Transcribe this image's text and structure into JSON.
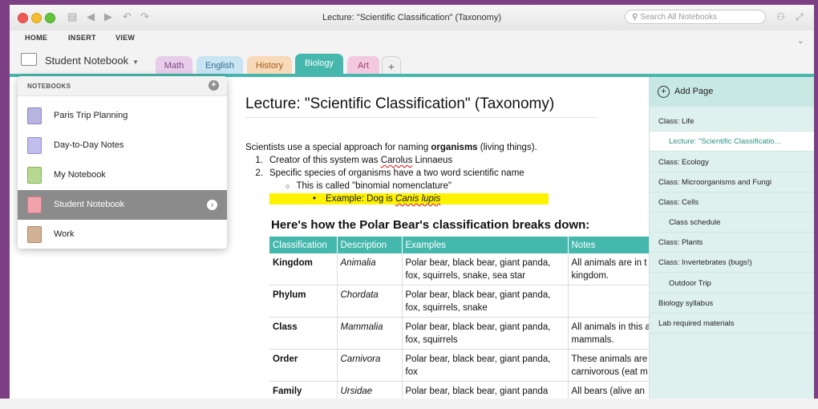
{
  "window": {
    "title": "Lecture: \"Scientific Classification\" (Taxonomy)",
    "search_placeholder": "Search All Notebooks"
  },
  "ribbon": {
    "tabs": [
      "HOME",
      "INSERT",
      "VIEW"
    ]
  },
  "notebook_selector": {
    "label": "Student Notebook"
  },
  "section_tabs": [
    {
      "label": "Math",
      "color": "#e7cde9"
    },
    {
      "label": "English",
      "color": "#c9e4f3"
    },
    {
      "label": "History",
      "color": "#f8d9b8"
    },
    {
      "label": "Biology",
      "color": "#46b7ad"
    },
    {
      "label": "Art",
      "color": "#f3c9df"
    },
    {
      "label": "+",
      "color": "#f0f0f0"
    }
  ],
  "notebooks": {
    "header": "NOTEBOOKS",
    "items": [
      {
        "label": "Paris Trip Planning",
        "color": "#b8b4e0"
      },
      {
        "label": "Day-to-Day Notes",
        "color": "#c1bdec"
      },
      {
        "label": "My Notebook",
        "color": "#b6d98f"
      },
      {
        "label": "Student Notebook",
        "color": "#f1a3ad",
        "selected": true
      },
      {
        "label": "Work",
        "color": "#d1b295"
      }
    ]
  },
  "page": {
    "title": "Lecture: \"Scientific Classification\" (Taxonomy)",
    "intro_prefix": "Scientists use a special approach for naming ",
    "intro_bold": "organisms",
    "intro_suffix": " (living things).",
    "list1_num": "1.",
    "list1_prefix": "Creator of this system was ",
    "list1_name": "Carolus",
    "list1_suffix": " Linnaeus",
    "list2_num": "2.",
    "list2_text": "Specific species of organisms have a two word scientific name",
    "sub_bullet": "○",
    "sub_text": "This is called \"binomial nomenclature\"",
    "example_bullet": "•",
    "example_prefix": "Example:  Dog is ",
    "example_italic": "Canis lupis",
    "subheading": "Here's how the Polar Bear's classification breaks down:",
    "table": {
      "headers": [
        "Classification",
        "Description",
        "Examples",
        "Notes"
      ],
      "rows": [
        [
          "Kingdom",
          "Animalia",
          "Polar bear, black bear, giant panda, fox, squirrels, snake, sea star",
          "All animals are in t kingdom."
        ],
        [
          "Phylum",
          "Chordata",
          "Polar bear, black bear, giant panda, fox, squirrels, snake",
          ""
        ],
        [
          "Class",
          "Mammalia",
          "Polar bear, black bear, giant panda, fox, squirrels",
          "All animals in this are mammals."
        ],
        [
          "Order",
          "Carnivora",
          "Polar bear, black bear, giant panda, fox",
          "These animals are carnivorous (eat m"
        ],
        [
          "Family",
          "Ursidae",
          "Polar bear, black bear, giant panda",
          "All bears (alive an"
        ]
      ]
    }
  },
  "pages_pane": {
    "add_label": "Add Page",
    "items": [
      {
        "label": "Class:  Life",
        "indent": false,
        "selected": false
      },
      {
        "label": "Lecture: \"Scientific Classificatio...",
        "indent": true,
        "selected": true
      },
      {
        "label": "Class: Ecology",
        "indent": false,
        "selected": false
      },
      {
        "label": "Class: Microorganisms and Fungi",
        "indent": false,
        "selected": false
      },
      {
        "label": "Class: Cells",
        "indent": false,
        "selected": false
      },
      {
        "label": "Class schedule",
        "indent": true,
        "selected": false
      },
      {
        "label": "Class: Plants",
        "indent": false,
        "selected": false
      },
      {
        "label": "Class: Invertebrates (bugs!)",
        "indent": false,
        "selected": false
      },
      {
        "label": "Outdoor Trip",
        "indent": true,
        "selected": false
      },
      {
        "label": "Biology syllabus",
        "indent": false,
        "selected": false
      },
      {
        "label": "Lab required materials",
        "indent": false,
        "selected": false
      }
    ]
  },
  "colors": {
    "accent": "#46b7ad",
    "window_border": "#7c3f83",
    "highlight": "#fff200"
  }
}
